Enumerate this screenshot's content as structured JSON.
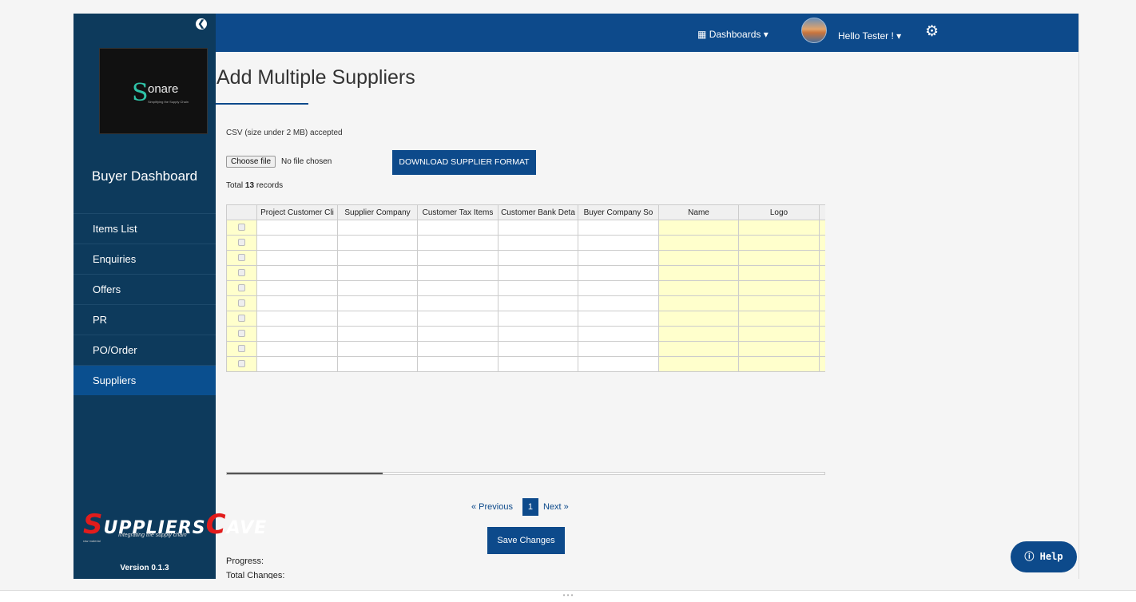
{
  "sidebar": {
    "logo_letter": "S",
    "logo_text": "onare",
    "logo_tagline": "Simplifying the Supply Chain",
    "dashboard_title": "Buyer Dashboard",
    "items": [
      {
        "label": "Items List"
      },
      {
        "label": "Enquiries"
      },
      {
        "label": "Offers"
      },
      {
        "label": "PR"
      },
      {
        "label": "PO/Order"
      },
      {
        "label": "Suppliers"
      }
    ],
    "active_item": "Suppliers",
    "brand_first": "S",
    "brand_mid": "UPPLIERS",
    "brand_c": "C",
    "brand_end": "AVE",
    "brand_tagline": "Integrating the supply chain",
    "brand_raw": "raw material",
    "version": "Version 0.1.3"
  },
  "topbar": {
    "dashboards_label": "Dashboards",
    "user_label": "Hello Tester !"
  },
  "main": {
    "title": "Add Multiple Suppliers",
    "csv_note": "CSV (size under 2 MB) accepted",
    "choose_file_label": "Choose file",
    "no_file_text": "No file chosen",
    "download_button": "DOWNLOAD SUPPLIER FORMAT",
    "records_prefix": "Total",
    "records_count": "13",
    "records_suffix": "records",
    "columns": [
      "Project Customer Cli",
      "Supplier Company",
      "Customer Tax Items",
      "Customer Bank Deta",
      "Buyer Company So",
      "Name",
      "Logo"
    ],
    "row_count": 10,
    "pager": {
      "previous": "« Previous",
      "current": "1",
      "next": "Next »"
    },
    "save_button": "Save Changes",
    "progress_label": "Progress:",
    "total_changes_label": "Total Changes:"
  },
  "help_label": "Help",
  "colors": {
    "primary": "#0d4a8b",
    "sidebar": "#0d3a5c",
    "highlight_cell": "#ffffcc"
  },
  "icons": [
    "collapse-icon",
    "grid-icon",
    "caret-down-icon",
    "gear-icon",
    "help-icon"
  ]
}
